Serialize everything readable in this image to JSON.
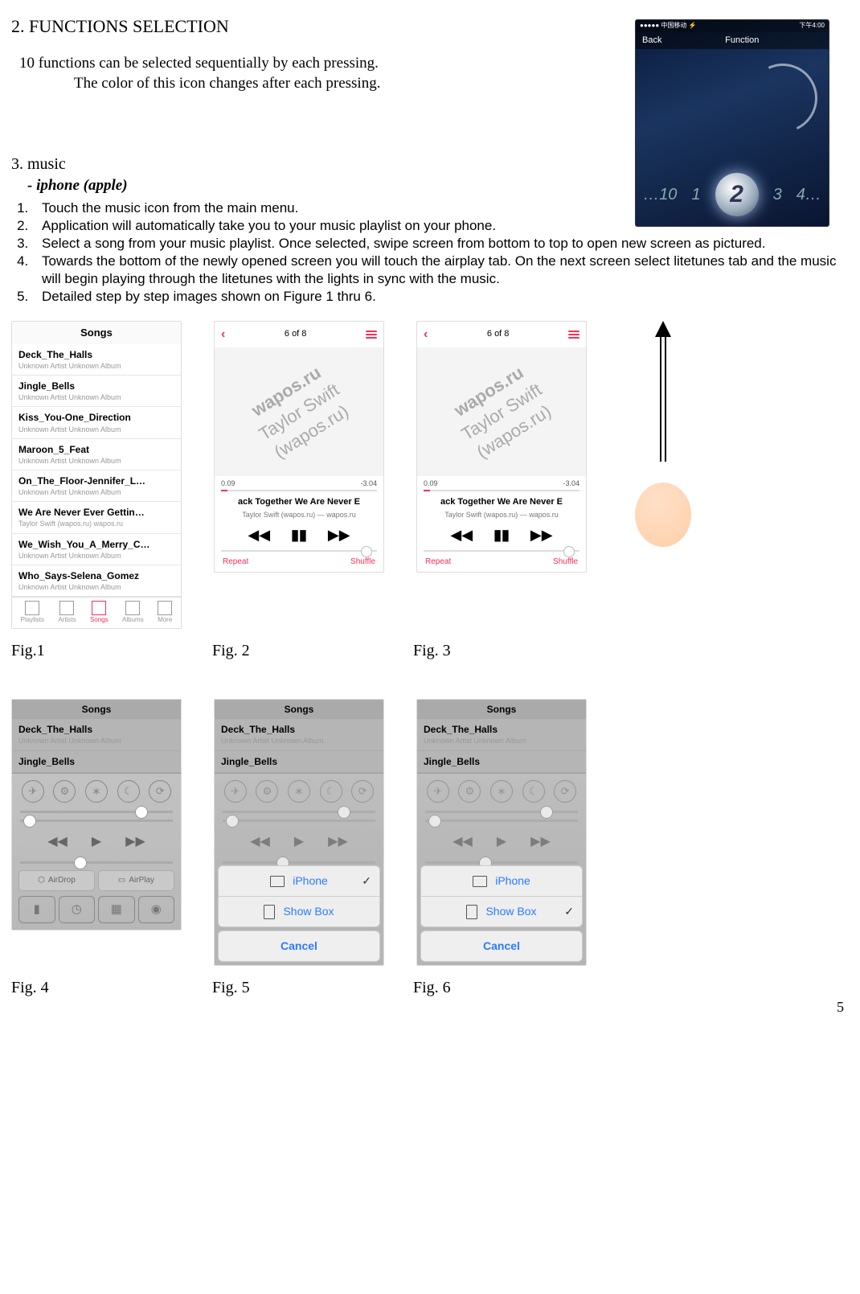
{
  "pageNumber": "5",
  "section2": {
    "title": "2.  FUNCTIONS SELECTION",
    "line1": "10 functions can be selected sequentially by each pressing.",
    "line2": "The color of this icon changes after each pressing."
  },
  "funcPhone": {
    "carrier": "●●●●● 中国移动 ⚡",
    "time": "下午4:00",
    "back": "Back",
    "title": "Function",
    "dial": [
      "…10",
      "1",
      "2",
      "3",
      "4…"
    ]
  },
  "section3": {
    "title": "3. music",
    "subtitle": "- iphone (apple)",
    "steps": [
      "Touch the music icon from the main menu.",
      "Application will automatically take you to your music playlist on your phone.",
      "Select a song from your music playlist. Once selected, swipe screen from bottom to top to open new screen as pictured.",
      "Towards the bottom of the newly opened screen you will touch the airplay tab.  On the next screen select litetunes tab and the music will begin playing through the litetunes with the lights in sync with the music.",
      "Detailed step by step images shown on Figure 1 thru 6."
    ]
  },
  "captions": {
    "f1": "Fig.1",
    "f2": "Fig. 2",
    "f3": "Fig. 3",
    "f4": "Fig. 4",
    "f5": "Fig. 5",
    "f6": "Fig. 6"
  },
  "songsHeader": "Songs",
  "songs": [
    {
      "t": "Deck_The_Halls",
      "s": "Unknown Artist  Unknown Album"
    },
    {
      "t": "Jingle_Bells",
      "s": "Unknown Artist  Unknown Album"
    },
    {
      "t": "Kiss_You-One_Direction",
      "s": "Unknown Artist  Unknown Album"
    },
    {
      "t": "Maroon_5_Feat",
      "s": "Unknown Artist  Unknown Album"
    },
    {
      "t": "On_The_Floor-Jennifer_L…",
      "s": "Unknown Artist  Unknown Album"
    },
    {
      "t": "We Are Never Ever Gettin…",
      "s": "Taylor Swift (wapos.ru)  wapos.ru"
    },
    {
      "t": "We_Wish_You_A_Merry_C…",
      "s": "Unknown Artist  Unknown Album"
    },
    {
      "t": "Who_Says-Selena_Gomez",
      "s": "Unknown Artist  Unknown Album"
    }
  ],
  "tabs": [
    "Playlists",
    "Artists",
    "Songs",
    "Albums",
    "More"
  ],
  "player": {
    "counter": "6 of 8",
    "elapsed": "0.09",
    "remaining": "-3.04",
    "marquee": "ack Together              We Are Never E",
    "info": "Taylor Swift (wapos.ru) — wapos.ru",
    "watermark1": "wapos.ru",
    "watermark2": "Taylor Swift",
    "watermark3": "(wapos.ru)",
    "repeat": "Repeat",
    "shuffle": "Shuffle"
  },
  "cc": {
    "dimSongs": [
      "Deck_The_Halls",
      "Jingle_Bells"
    ],
    "airdrop": "AirDrop",
    "airplay": "AirPlay",
    "airplaySheet": {
      "iphone": "iPhone",
      "showbox": "Show Box",
      "cancel": "Cancel"
    }
  }
}
